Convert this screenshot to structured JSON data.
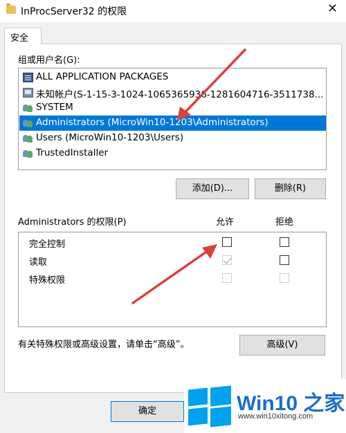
{
  "window": {
    "title": "InProcServer32 的权限",
    "close_glyph": "✕"
  },
  "tabs": [
    {
      "label": "安全"
    }
  ],
  "group_label": "组或用户名(G):",
  "users": [
    {
      "name": "ALL APPLICATION PACKAGES",
      "icon": "packages-icon"
    },
    {
      "name": "未知帐户(S-1-15-3-1024-1065365936-1281604716-3511738...",
      "icon": "unknown-account-icon"
    },
    {
      "name": "SYSTEM",
      "icon": "group-icon"
    },
    {
      "name": "Administrators (MicroWin10-1203\\Administrators)",
      "icon": "group-icon",
      "selected": true
    },
    {
      "name": "Users (MicroWin10-1203\\Users)",
      "icon": "group-icon"
    },
    {
      "name": "TrustedInstaller",
      "icon": "group-icon"
    }
  ],
  "buttons": {
    "add": "添加(D)...",
    "remove": "删除(R)",
    "advanced": "高级(V)",
    "ok": "确定"
  },
  "permissions": {
    "header": "Administrators 的权限(P)",
    "allow_header": "允许",
    "deny_header": "拒绝",
    "rows": [
      {
        "label": "完全控制",
        "allow": false,
        "deny": false,
        "allow_disabled": false,
        "deny_disabled": false
      },
      {
        "label": "读取",
        "allow": true,
        "deny": false,
        "allow_disabled": true,
        "deny_disabled": false
      },
      {
        "label": "特殊权限",
        "allow": false,
        "deny": false,
        "allow_disabled": true,
        "deny_disabled": true
      }
    ]
  },
  "advanced_hint": "有关特殊权限或高级设置，请单击“高级”。",
  "watermark": {
    "brand": "Win10 之家",
    "site": "www.win10xitong.com",
    "color": "#1a6fc9"
  },
  "colors": {
    "selection": "#0078d7",
    "annotation_arrow": "#d9413a"
  }
}
